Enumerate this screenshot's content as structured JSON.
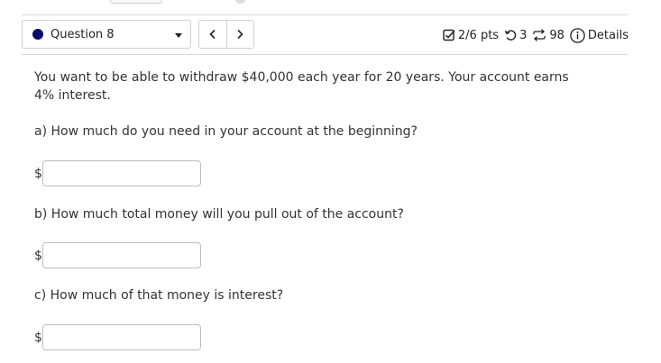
{
  "header": {
    "question_label": "Question 8",
    "points": "2/6 pts",
    "retries": "3",
    "attempts": "98",
    "details_label": "Details"
  },
  "question": {
    "text": "You want to be able to withdraw $40,000 each year for 20 years. Your account earns 4% interest.",
    "parts": [
      {
        "prompt": "a) How much do you need in your account at the beginning?",
        "currency": "$",
        "value": ""
      },
      {
        "prompt": "b) How much total money will you pull out of the account?",
        "currency": "$",
        "value": ""
      },
      {
        "prompt": "c) How much of that money is interest?",
        "currency": "$",
        "value": ""
      }
    ]
  },
  "icons": {
    "status": "filled-circle-icon",
    "dropdown": "caret-down-icon",
    "prev": "chevron-left-icon",
    "next": "chevron-right-icon",
    "points": "checkbox-icon",
    "retries": "undo-icon",
    "attempts": "repeat-icon",
    "details": "info-icon"
  },
  "colors": {
    "status_dot": "#0b0b6b",
    "border": "#cfcfcf",
    "text": "#333333"
  }
}
